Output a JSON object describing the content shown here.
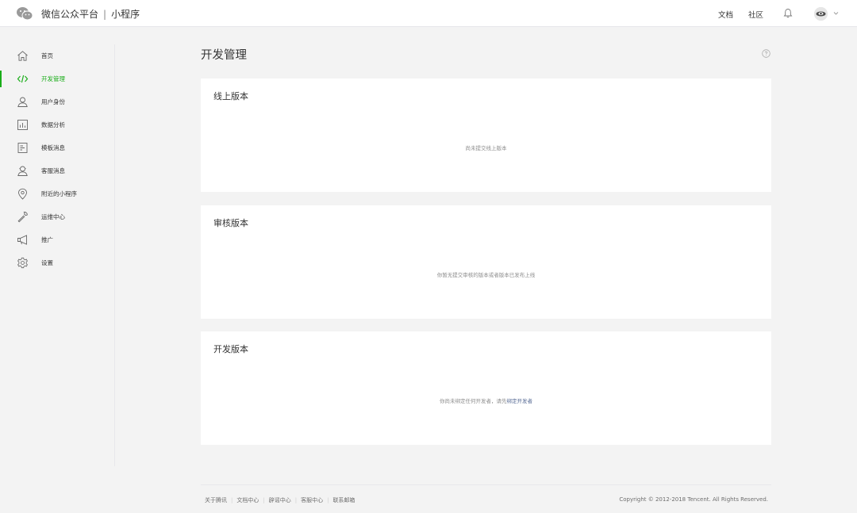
{
  "header": {
    "brand_main": "微信公众平台",
    "brand_separator": "|",
    "brand_sub": "小程序",
    "docs_link": "文档",
    "community_link": "社区",
    "logo_icon": "wechat-logo-icon",
    "bell_icon": "bell-icon",
    "caret_icon": "chevron-down-icon"
  },
  "sidebar": {
    "items": [
      {
        "label": "首页",
        "icon": "home-icon"
      },
      {
        "label": "开发管理",
        "icon": "code-icon",
        "active": true
      },
      {
        "label": "用户身份",
        "icon": "user-icon"
      },
      {
        "label": "数据分析",
        "icon": "bar-chart-icon"
      },
      {
        "label": "模板消息",
        "icon": "document-icon"
      },
      {
        "label": "客服消息",
        "icon": "customer-service-icon"
      },
      {
        "label": "附近的小程序",
        "icon": "location-pin-icon"
      },
      {
        "label": "运维中心",
        "icon": "wrench-icon"
      },
      {
        "label": "推广",
        "icon": "megaphone-icon"
      },
      {
        "label": "设置",
        "icon": "gear-icon"
      }
    ],
    "accent_color": "#1aad19"
  },
  "main": {
    "title": "开发管理",
    "help_icon": "question-circle-icon",
    "cards": [
      {
        "title": "线上版本",
        "empty_text": "尚未提交线上版本"
      },
      {
        "title": "审核版本",
        "empty_text": "你暂无提交审核的版本或者版本已发布上线"
      },
      {
        "title": "开发版本",
        "empty_text": "你尚未绑定任何开发者，请先",
        "empty_link": "绑定开发者"
      }
    ]
  },
  "footer": {
    "links": [
      "关于腾讯",
      "文档中心",
      "辟谣中心",
      "客服中心",
      "联系邮箱"
    ],
    "copyright": "Copyright © 2012-2018 Tencent. All Rights Reserved."
  }
}
